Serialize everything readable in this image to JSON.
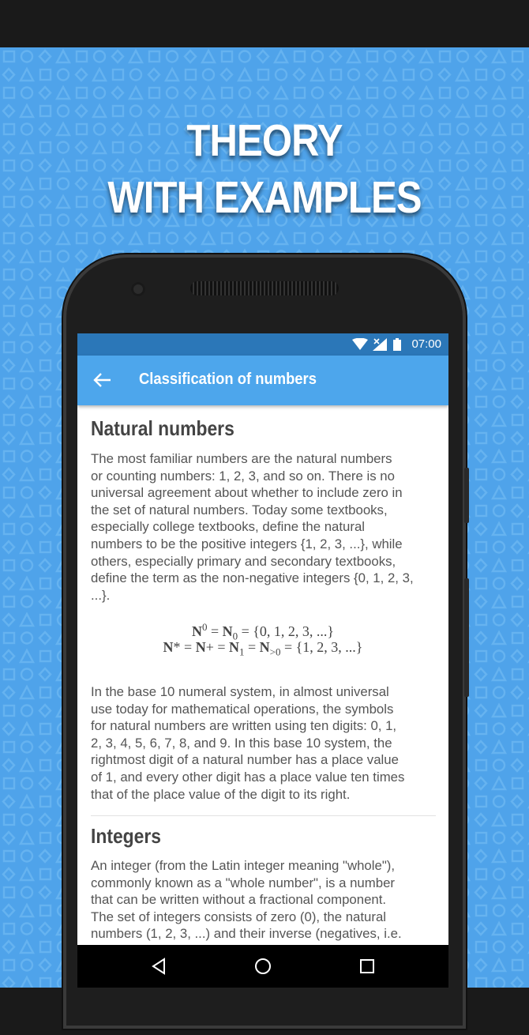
{
  "headline": {
    "line1": "THEORY",
    "line2": "WITH EXAMPLES"
  },
  "status_bar": {
    "time": "07:00",
    "icons": [
      "wifi-icon",
      "signal-icon",
      "battery-icon"
    ]
  },
  "app_bar": {
    "title": "Classification of numbers",
    "back_icon": "arrow-back-icon"
  },
  "sections": [
    {
      "title": "Natural numbers",
      "para1_lines": [
        "The most familiar numbers are the natural numbers",
        "or counting numbers: 1, 2, 3, and so on. There is no",
        "universal agreement about whether to include zero in",
        "the set of natural numbers. Today some textbooks,",
        "especially college textbooks, define the natural",
        "numbers to be the positive integers {1, 2, 3, ...}, while",
        "others, especially primary and secondary textbooks,",
        "define the term as the non-negative integers {0, 1, 2, 3,",
        "...}."
      ],
      "formula1": {
        "lhs": "N",
        "sup0": "0",
        "eq1": " = ",
        "n2": "N",
        "sub0": "0",
        "rest": " = {0, 1, 2, 3, ...}"
      },
      "formula2": {
        "a": "N",
        "a_sup": "*",
        "eq1": " = ",
        "b": "N",
        "b_sup": "+",
        "eq2": " = ",
        "c": "N",
        "c_sub": "1",
        "eq3": " = ",
        "d": "N",
        "d_sub": ">0",
        "rest": " = {1, 2, 3, ...}"
      },
      "para2_lines": [
        "In the base 10 numeral system, in almost universal",
        "use today for mathematical operations, the symbols",
        "for natural numbers are written using ten digits: 0, 1,",
        "2, 3, 4, 5, 6, 7, 8, and 9. In this base 10 system, the",
        "rightmost digit of a natural number has a place value",
        "of 1, and every other digit has a place value ten times",
        "that of the place value of the digit to its right."
      ]
    },
    {
      "title": "Integers",
      "para1_lines": [
        "An integer (from the Latin integer meaning \"whole\"),",
        "commonly known as a \"whole number\", is a number",
        "that can be written without a fractional component.",
        "The set of integers consists of zero (0), the natural",
        "numbers (1, 2, 3, ...) and their inverse (negatives, i.e."
      ]
    }
  ],
  "nav_bar": {
    "icons": [
      "back-triangle-icon",
      "home-circle-icon",
      "recents-square-icon"
    ]
  },
  "colors": {
    "background": "#4fa3ea",
    "status_bar": "#2b77b8",
    "app_bar": "#4da6ec",
    "text": "#555555"
  }
}
